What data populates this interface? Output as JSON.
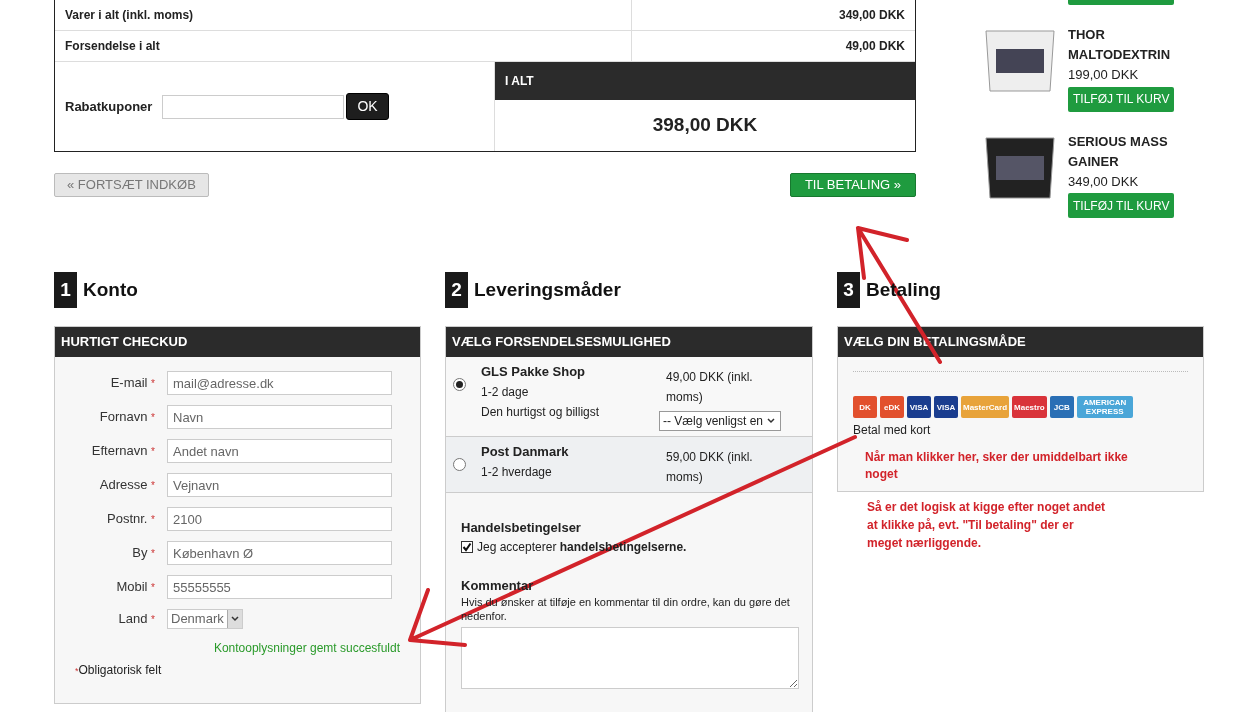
{
  "summary": {
    "rows": [
      {
        "label": "Varer i alt (inkl. moms)",
        "value": "349,00 DKK"
      },
      {
        "label": "Forsendelse i alt",
        "value": "49,00 DKK"
      }
    ],
    "coupon": {
      "label": "Rabatkuponer",
      "button": "OK"
    },
    "total": {
      "label": "I ALT",
      "amount": "398,00 DKK"
    }
  },
  "buttons": {
    "continue": "« FORTSÆT INDKØB",
    "checkout": "TIL BETALING »"
  },
  "products": [
    {
      "name": "THOR MALTODEXTRIN",
      "price": "199,00 DKK",
      "button": "TILFØJ TIL KURV"
    },
    {
      "name": "SERIOUS MASS GAINER",
      "price": "349,00 DKK",
      "button": "TILFØJ TIL KURV"
    }
  ],
  "account": {
    "number": "1",
    "title": "Konto",
    "panel_title": "HURTIGT CHECKUD",
    "fields": [
      {
        "label": "E-mail",
        "required": "*",
        "value": "mail@adresse.dk",
        "kind": "text"
      },
      {
        "label": "Fornavn",
        "required": "*",
        "value": "Navn",
        "kind": "text"
      },
      {
        "label": "Efternavn",
        "required": "*",
        "value": "Andet navn",
        "kind": "text"
      },
      {
        "label": "Adresse",
        "required": "*",
        "value": "Vejnavn",
        "kind": "text"
      },
      {
        "label": "Postnr.",
        "required": "*",
        "value": "2100",
        "kind": "text"
      },
      {
        "label": "By",
        "required": "*",
        "value": "København Ø",
        "kind": "text"
      },
      {
        "label": "Mobil",
        "required": "*",
        "value": "55555555",
        "kind": "text"
      },
      {
        "label": "Land",
        "required": "*",
        "value": "Denmark",
        "kind": "select"
      }
    ],
    "success": "Kontooplysninger gemt succesfuldt",
    "required_mark": "*",
    "required_note": "Obligatorisk felt"
  },
  "delivery": {
    "number": "2",
    "title": "Leveringsmåder",
    "panel_title": "VÆLG FORSENDELSESMULIGHED",
    "options": [
      {
        "name": "GLS Pakke Shop",
        "lines": [
          "1-2 dage",
          "Den hurtigst og billigst"
        ],
        "price": "49,00 DKK (inkl. moms)",
        "select": "-- Vælg venligst en",
        "selected": true
      },
      {
        "name": "Post Danmark",
        "lines": [
          "1-2 hverdage"
        ],
        "price": "59,00 DKK (inkl. moms)",
        "selected": false
      }
    ],
    "terms_title": "Handelsbetingelser",
    "terms_text": "Jeg accepterer **handelsbetingelserne.**",
    "terms_checked": true,
    "comment_title": "Kommentar",
    "comment_help": "Hvis du ønsker at tilføje en kommentar til din ordre, kan du gøre det nedenfor."
  },
  "payment": {
    "number": "3",
    "title": "Betaling",
    "panel_title": "VÆLG DIN BETALINGSMÅDE",
    "logos": [
      {
        "label": "DK",
        "color": "#e2502d"
      },
      {
        "label": "eDK",
        "color": "#e2502d"
      },
      {
        "label": "VISA",
        "color": "#1a3d8f"
      },
      {
        "label": "VISA",
        "color": "#1a3d8f"
      },
      {
        "label": "MasterCard",
        "color": "#e8a33a"
      },
      {
        "label": "Maestro",
        "color": "#d9333a"
      },
      {
        "label": "JCB",
        "color": "#2a6fb5"
      },
      {
        "label": "AMERICAN EXPRESS",
        "color": "#4aa6d8"
      }
    ],
    "method": "Betal med kort"
  },
  "annotations": [
    "Når man klikker her, sker der umiddelbart ikke noget",
    "Så er det logisk at kigge efter noget andet at klikke på, evt. \"Til betaling\" der er meget nærliggende."
  ]
}
